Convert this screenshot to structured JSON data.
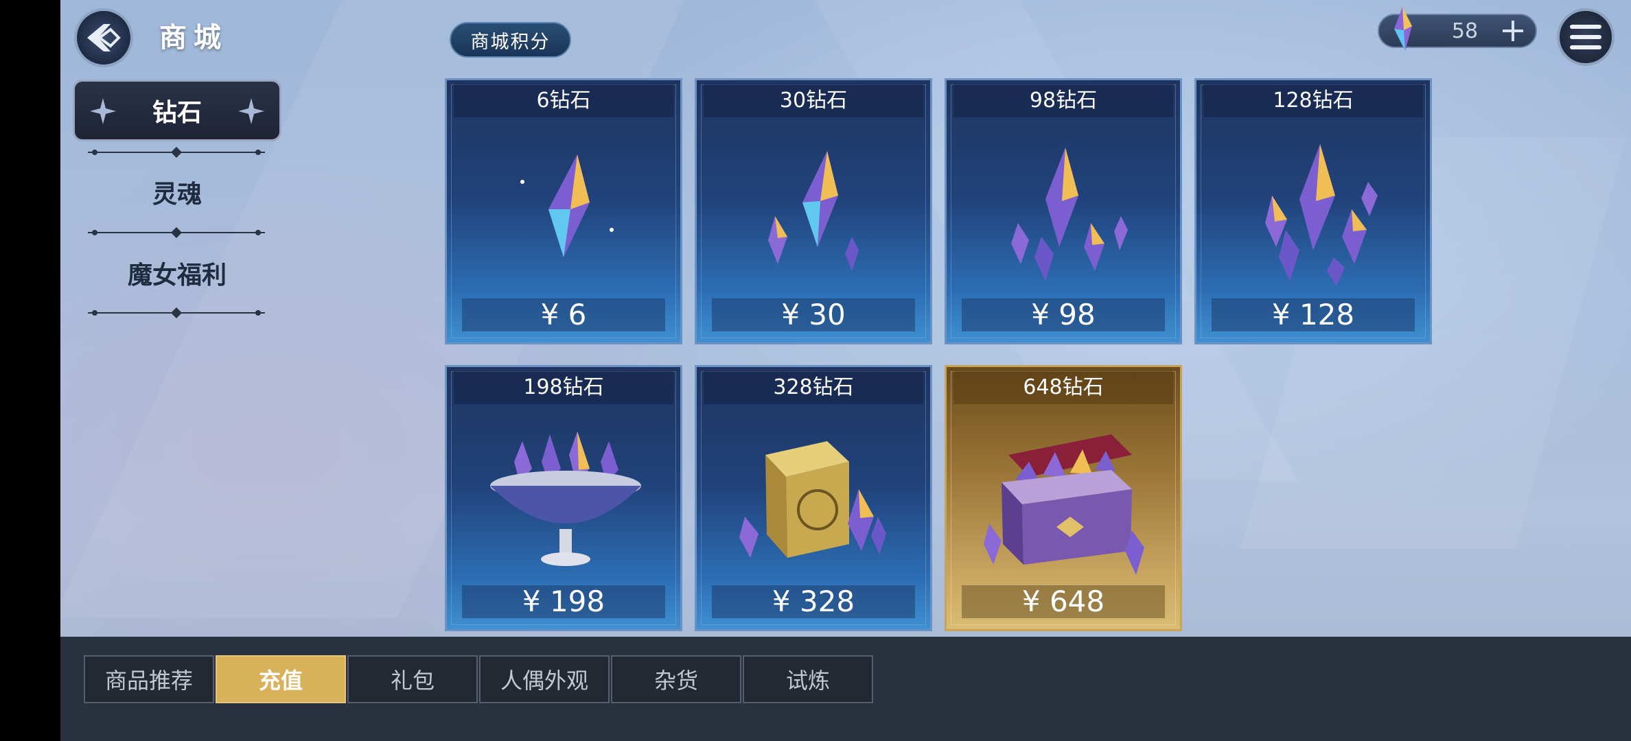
{
  "header": {
    "title": "商城",
    "points_button": "商城积分",
    "currency_amount": "58"
  },
  "sidebar": {
    "items": [
      {
        "label": "钻石",
        "active": true
      },
      {
        "label": "灵魂",
        "active": false
      },
      {
        "label": "魔女福利",
        "active": false
      }
    ]
  },
  "products": [
    {
      "title": "6钻石",
      "price": "¥ 6",
      "art": "single-crystal-icon"
    },
    {
      "title": "30钻石",
      "price": "¥ 30",
      "art": "crystal-cluster-small-icon"
    },
    {
      "title": "98钻石",
      "price": "¥ 98",
      "art": "crystal-cluster-medium-icon"
    },
    {
      "title": "128钻石",
      "price": "¥ 128",
      "art": "crystal-cluster-large-icon"
    },
    {
      "title": "198钻石",
      "price": "¥ 198",
      "art": "crystal-bowl-icon"
    },
    {
      "title": "328钻石",
      "price": "¥ 328",
      "art": "golden-cube-icon"
    },
    {
      "title": "648钻石",
      "price": "¥ 648",
      "art": "treasure-chest-icon"
    }
  ],
  "tabs": [
    {
      "label": "商品推荐",
      "active": false
    },
    {
      "label": "充值",
      "active": true
    },
    {
      "label": "礼包",
      "active": false
    },
    {
      "label": "人偶外观",
      "active": false
    },
    {
      "label": "杂货",
      "active": false
    },
    {
      "label": "试炼",
      "active": false
    }
  ],
  "colors": {
    "tab_active": "#d9b15a",
    "card_blue": "#2c6db3",
    "card_gold": "#c9a761"
  }
}
